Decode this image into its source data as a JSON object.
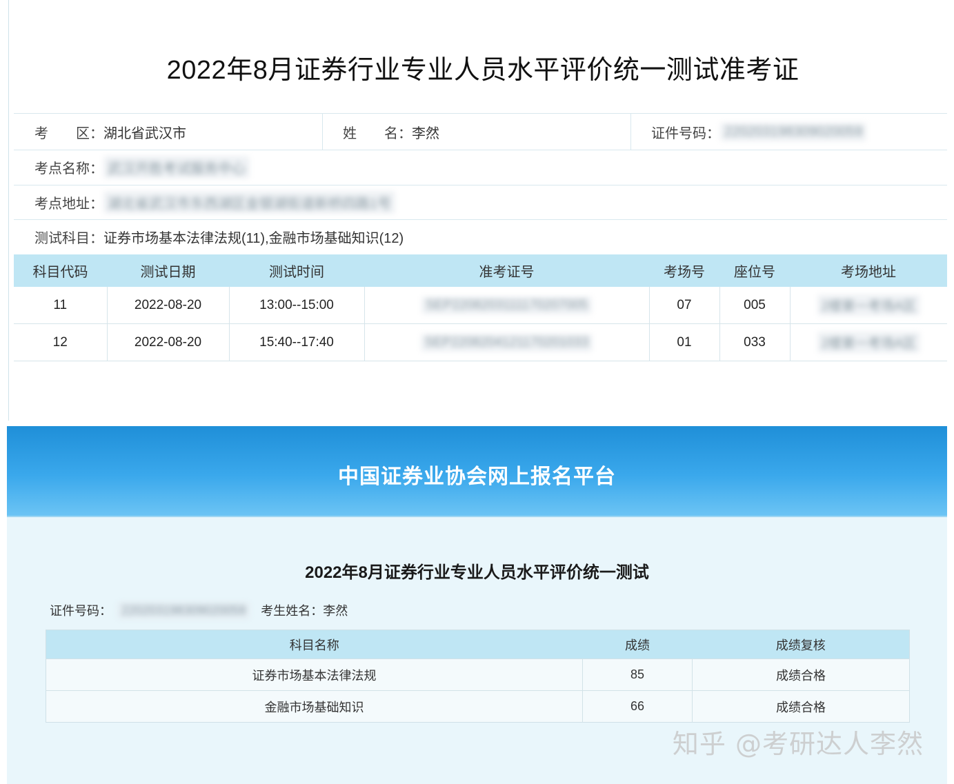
{
  "ticket": {
    "title": "2022年8月证券行业专业人员水平评价统一测试准考证",
    "exam_area_label": "考　　区：",
    "exam_area": "湖北省武汉市",
    "name_label": "姓　　名：",
    "name": "李然",
    "id_label": "证件号码：",
    "id_number": "220203198309020059",
    "site_name_label": "考点名称：",
    "site_name": "武汉开胜考试服务中心",
    "site_address_label": "考点地址：",
    "site_address": "湖北省武汉市东西湖区金银湖街道新桥四路1号",
    "subjects_label": "测试科目：",
    "subjects": "证券市场基本法律法规(11),金融市场基础知识(12)",
    "table": {
      "headers": [
        "科目代码",
        "测试日期",
        "测试时间",
        "准考证号",
        "考场号",
        "座位号",
        "考场地址"
      ],
      "rows": [
        [
          "11",
          "2022-08-20",
          "13:00--15:00",
          "SEP2208203111170207005",
          "07",
          "005",
          "2楼第一考场A区"
        ],
        [
          "12",
          "2022-08-20",
          "15:40--17:40",
          "SEP2208204121170201033",
          "01",
          "033",
          "2楼第一考场A区"
        ]
      ]
    }
  },
  "score": {
    "banner_title": "中国证券业协会网上报名平台",
    "heading": "2022年8月证券行业专业人员水平评价统一测试",
    "id_label": "证件号码：",
    "id_number": "220203198309020059",
    "name_label": "考生姓名：",
    "name": "李然",
    "table": {
      "headers": [
        "科目名称",
        "成绩",
        "成绩复核"
      ],
      "rows": [
        [
          "证券市场基本法律法规",
          "85",
          "成绩合格"
        ],
        [
          "金融市场基础知识",
          "66",
          "成绩合格"
        ]
      ]
    }
  },
  "watermark": "知乎 @考研达人李然",
  "colors": {
    "header_row": "#bfe6f4",
    "banner_top": "#1f8fd8",
    "banner_bottom": "#6cc4f4",
    "score_bg": "#e9f6fb"
  }
}
